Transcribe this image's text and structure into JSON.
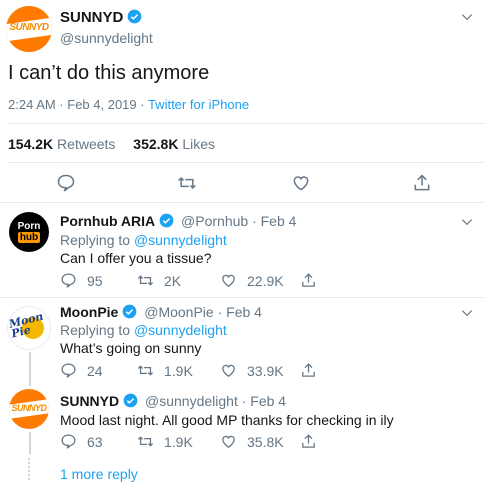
{
  "main_tweet": {
    "display_name": "SUNNYD",
    "handle": "@sunnydelight",
    "avatar_text": "SUNNYD",
    "text": "I can’t do this anymore",
    "meta_time": "2:24 AM · Feb 4, 2019 · ",
    "meta_source": "Twitter for iPhone",
    "retweets_count": "154.2K",
    "retweets_label": "Retweets",
    "likes_count": "352.8K",
    "likes_label": "Likes"
  },
  "replies": [
    {
      "display_name": "Pornhub ARIA",
      "handle_date": "@Pornhub · Feb 4",
      "avatar_line1": "Porn",
      "avatar_line2": "hub",
      "replying_prefix": "Replying to ",
      "replying_to": "@sunnydelight",
      "text": "Can I offer you a tissue?",
      "replies": "95",
      "retweets": "2K",
      "likes": "22.9K"
    },
    {
      "display_name": "MoonPie",
      "handle_date": "@MoonPie · Feb 4",
      "avatar_text": "Moon Pie",
      "replying_prefix": "Replying to ",
      "replying_to": "@sunnydelight",
      "text": "What’s going on sunny",
      "replies": "24",
      "retweets": "1.9K",
      "likes": "33.9K"
    },
    {
      "display_name": "SUNNYD",
      "handle_date": "@sunnydelight · Feb 4",
      "avatar_text": "SUNNYD",
      "text": "Mood last night. All good MP thanks for checking in ily",
      "replies": "63",
      "retweets": "1.9K",
      "likes": "35.8K"
    }
  ],
  "more_replies": "1 more reply",
  "icons": [
    "chevron-down-icon",
    "verified-badge-icon",
    "reply-icon",
    "retweet-icon",
    "like-icon",
    "share-icon"
  ],
  "colors": {
    "link_blue": "#1da1f2",
    "muted": "#657786",
    "sunnyd_orange": "#ff7a00",
    "divider": "#e6ecf0"
  }
}
